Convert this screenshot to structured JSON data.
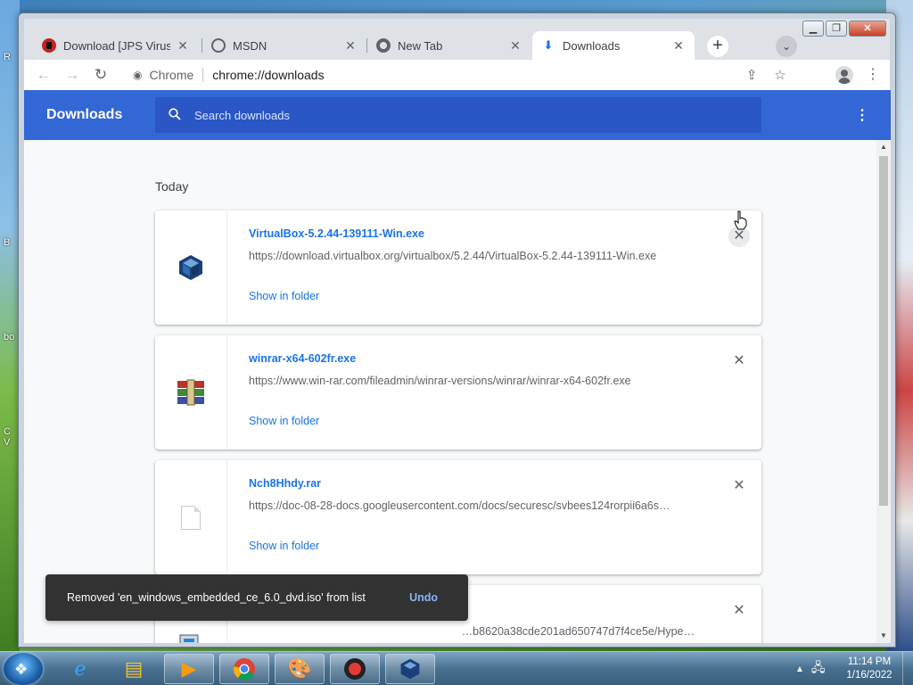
{
  "desktop": {
    "left_labels": [
      "R",
      "B",
      "bo",
      "C",
      "V"
    ]
  },
  "tabs": [
    {
      "label": "Download [JPS Virus Mak",
      "favicon": "red-n-icon"
    },
    {
      "label": "MSDN",
      "favicon": "globe-icon"
    },
    {
      "label": "New Tab",
      "favicon": "chrome-icon"
    },
    {
      "label": "Downloads",
      "favicon": "download-icon"
    }
  ],
  "omnibox": {
    "chip": "Chrome",
    "url": "chrome://downloads"
  },
  "downloads_page": {
    "title": "Downloads",
    "search_placeholder": "Search downloads",
    "section_label": "Today",
    "items": [
      {
        "name": "VirtualBox-5.2.44-139111-Win.exe",
        "url": "https://download.virtualbox.org/virtualbox/5.2.44/VirtualBox-5.2.44-139111-Win.exe",
        "action": "Show in folder",
        "icon": "virtualbox-icon"
      },
      {
        "name": "winrar-x64-602fr.exe",
        "url": "https://www.win-rar.com/fileadmin/winrar-versions/winrar/winrar-x64-602fr.exe",
        "action": "Show in folder",
        "icon": "winrar-icon"
      },
      {
        "name": "Nch8Hhdy.rar",
        "url": "https://doc-08-28-docs.googleusercontent.com/docs/securesc/svbees124rorpii6a6s…",
        "action": "Show in folder",
        "icon": "file-icon"
      },
      {
        "name": "",
        "url": "…b8620a38cde201ad650747d7f4ce5e/Hype…",
        "action": "",
        "icon": "installer-icon"
      }
    ]
  },
  "snackbar": {
    "message": "Removed 'en_windows_embedded_ce_6.0_dvd.iso' from list",
    "undo": "Undo"
  },
  "taskbar": {
    "apps": [
      "ie-icon",
      "explorer-icon",
      "media-player-icon",
      "chrome-icon",
      "paint-icon",
      "recorder-icon",
      "virtualbox-icon"
    ],
    "time": "11:14 PM",
    "date": "1/16/2022"
  },
  "colors": {
    "header_blue": "#3367d6",
    "link_blue": "#1a73e8",
    "snackbar_bg": "#323232"
  }
}
